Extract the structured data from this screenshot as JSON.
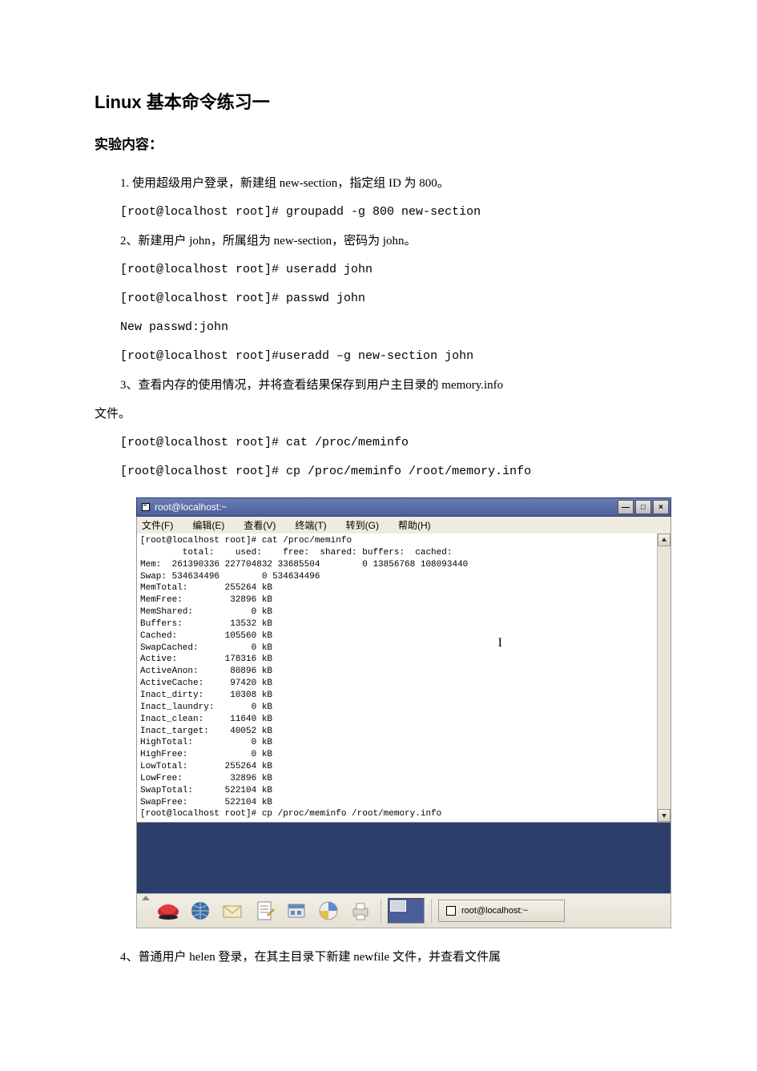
{
  "doc": {
    "title": "Linux 基本命令练习一",
    "section_heading": "实验内容：",
    "l1": "1. 使用超级用户登录，新建组 new-section，指定组 ID 为 800。",
    "l2": "[root@localhost root]# groupadd -g 800 new-section",
    "l3": "2、新建用户 john，所属组为 new-section，密码为 john。",
    "l4": "[root@localhost root]# useradd john",
    "l5": "[root@localhost root]# passwd john",
    "l6": "New passwd:john",
    "l7": "[root@localhost root]#useradd –g new-section john",
    "l8": "3、查看内存的使用情况，并将查看结果保存到用户主目录的 memory.info",
    "l8b": "文件。",
    "l9": "[root@localhost root]# cat /proc/meminfo",
    "l10": "[root@localhost root]# cp /proc/meminfo /root/memory.info",
    "l11": "4、普通用户 helen 登录，在其主目录下新建 newfile 文件，并查看文件属"
  },
  "window": {
    "title": "root@localhost:~",
    "btn_min": "—",
    "btn_max": "□",
    "btn_close": "×",
    "menu": {
      "file": "文件(F)",
      "edit": "编辑(E)",
      "view": "查看(V)",
      "terminal": "终端(T)",
      "go": "转到(G)",
      "help": "帮助(H)"
    }
  },
  "terminal_output": "[root@localhost root]# cat /proc/meminfo\n        total:    used:    free:  shared: buffers:  cached:\nMem:  261390336 227704832 33685504        0 13856768 108093440\nSwap: 534634496        0 534634496\nMemTotal:       255264 kB\nMemFree:         32896 kB\nMemShared:           0 kB\nBuffers:         13532 kB\nCached:         105560 kB\nSwapCached:          0 kB\nActive:         178316 kB\nActiveAnon:      80896 kB\nActiveCache:     97420 kB\nInact_dirty:     10308 kB\nInact_laundry:       0 kB\nInact_clean:     11640 kB\nInact_target:    40052 kB\nHighTotal:           0 kB\nHighFree:            0 kB\nLowTotal:       255264 kB\nLowFree:         32896 kB\nSwapTotal:      522104 kB\nSwapFree:       522104 kB\n[root@localhost root]# cp /proc/meminfo /root/memory.info",
  "panel": {
    "task_label": "root@localhost:~"
  }
}
